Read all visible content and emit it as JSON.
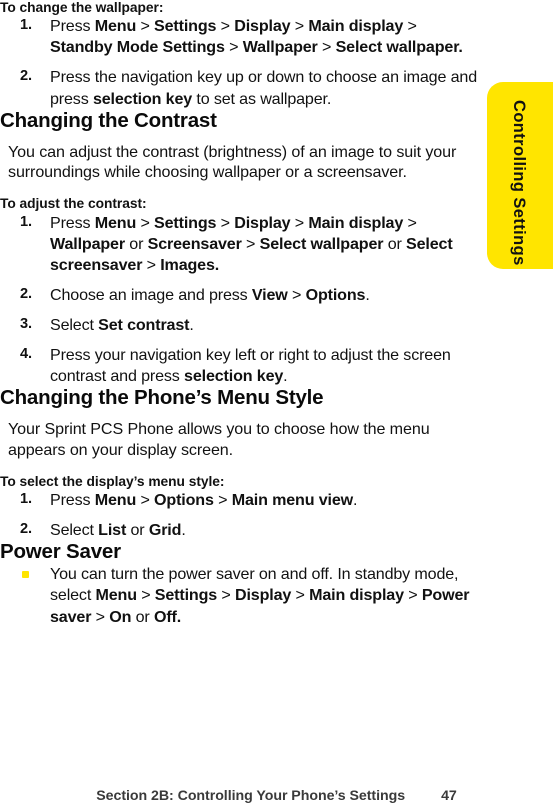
{
  "page": {
    "side_tab_label": "Controlling Settings",
    "side_tab_color": "#ffe500",
    "bullet_color": "#ffe500"
  },
  "footer": {
    "text": "Section 2B: Controlling Your Phone’s Settings",
    "page_number": "47"
  },
  "wallpaper_section": {
    "sub_heading": "To change the wallpaper:",
    "steps": [
      {
        "num": "1.",
        "parts": [
          {
            "t": "Press ",
            "b": false
          },
          {
            "t": "Menu",
            "b": true
          },
          {
            "t": " > ",
            "b": false
          },
          {
            "t": "Settings",
            "b": true
          },
          {
            "t": " > ",
            "b": false
          },
          {
            "t": "Display",
            "b": true
          },
          {
            "t": " > ",
            "b": false
          },
          {
            "t": "Main display",
            "b": true
          },
          {
            "t": " > ",
            "b": false
          },
          {
            "t": "Standby Mode Settings",
            "b": true
          },
          {
            "t": " > ",
            "b": false
          },
          {
            "t": "Wallpaper",
            "b": true
          },
          {
            "t": " > ",
            "b": false
          },
          {
            "t": "Select wallpaper.",
            "b": true
          }
        ]
      },
      {
        "num": "2.",
        "parts": [
          {
            "t": "Press the navigation key up or down to choose an image and press ",
            "b": false
          },
          {
            "t": "selection key",
            "b": true
          },
          {
            "t": " to set as wallpaper.",
            "b": false
          }
        ]
      }
    ]
  },
  "contrast_section": {
    "heading": "Changing the Contrast",
    "paragraph": "You can adjust the contrast (brightness) of an image to suit your surroundings while choosing wallpaper or  a screensaver.",
    "sub_heading": "To adjust the contrast:",
    "steps": [
      {
        "num": "1.",
        "parts": [
          {
            "t": "Press ",
            "b": false
          },
          {
            "t": "Menu",
            "b": true
          },
          {
            "t": " > ",
            "b": false
          },
          {
            "t": "Settings",
            "b": true
          },
          {
            "t": " > ",
            "b": false
          },
          {
            "t": "Display",
            "b": true
          },
          {
            "t": " > ",
            "b": false
          },
          {
            "t": "Main display",
            "b": true
          },
          {
            "t": " > ",
            "b": false
          },
          {
            "t": "Wallpaper",
            "b": true
          },
          {
            "t": " or ",
            "b": false
          },
          {
            "t": "Screensaver",
            "b": true
          },
          {
            "t": " > ",
            "b": false
          },
          {
            "t": "Select wallpaper",
            "b": true
          },
          {
            "t": " or ",
            "b": false
          },
          {
            "t": "Select screensaver",
            "b": true
          },
          {
            "t": " > ",
            "b": false
          },
          {
            "t": "Images.",
            "b": true
          }
        ]
      },
      {
        "num": "2.",
        "parts": [
          {
            "t": "Choose an image and press ",
            "b": false
          },
          {
            "t": "View",
            "b": true
          },
          {
            "t": " > ",
            "b": false
          },
          {
            "t": "Options",
            "b": true
          },
          {
            "t": ".",
            "b": false
          }
        ]
      },
      {
        "num": "3.",
        "parts": [
          {
            "t": "Select ",
            "b": false
          },
          {
            "t": "Set contrast",
            "b": true
          },
          {
            "t": ".",
            "b": false
          }
        ]
      },
      {
        "num": "4.",
        "parts": [
          {
            "t": "Press your navigation key left or right to adjust the screen contrast and press ",
            "b": false
          },
          {
            "t": "selection key",
            "b": true
          },
          {
            "t": ".",
            "b": false
          }
        ]
      }
    ]
  },
  "menu_style_section": {
    "heading": "Changing the Phone’s Menu Style",
    "paragraph": "Your Sprint PCS Phone allows you to choose how the menu appears on your display screen.",
    "sub_heading": "To select the display’s menu style:",
    "steps": [
      {
        "num": "1.",
        "parts": [
          {
            "t": "Press ",
            "b": false
          },
          {
            "t": "Menu",
            "b": true
          },
          {
            "t": " > ",
            "b": false
          },
          {
            "t": "Options",
            "b": true
          },
          {
            "t": " > ",
            "b": false
          },
          {
            "t": "Main menu view",
            "b": true
          },
          {
            "t": ".",
            "b": false
          }
        ]
      },
      {
        "num": "2.",
        "parts": [
          {
            "t": "Select ",
            "b": false
          },
          {
            "t": "List",
            "b": true
          },
          {
            "t": " or ",
            "b": false
          },
          {
            "t": "Grid",
            "b": true
          },
          {
            "t": ".",
            "b": false
          }
        ]
      }
    ]
  },
  "power_saver_section": {
    "heading": "Power Saver",
    "bullets": [
      {
        "parts": [
          {
            "t": "You can turn the power saver on and off. In standby mode, select ",
            "b": false
          },
          {
            "t": "Menu",
            "b": true
          },
          {
            "t": " > ",
            "b": false
          },
          {
            "t": "Settings",
            "b": true
          },
          {
            "t": " > ",
            "b": false
          },
          {
            "t": "Display",
            "b": true
          },
          {
            "t": " > ",
            "b": false
          },
          {
            "t": "Main display",
            "b": true
          },
          {
            "t": " > ",
            "b": false
          },
          {
            "t": "Power saver",
            "b": true
          },
          {
            "t": " > ",
            "b": false
          },
          {
            "t": "On",
            "b": true
          },
          {
            "t": " or ",
            "b": false
          },
          {
            "t": "Off.",
            "b": true
          }
        ]
      }
    ]
  }
}
